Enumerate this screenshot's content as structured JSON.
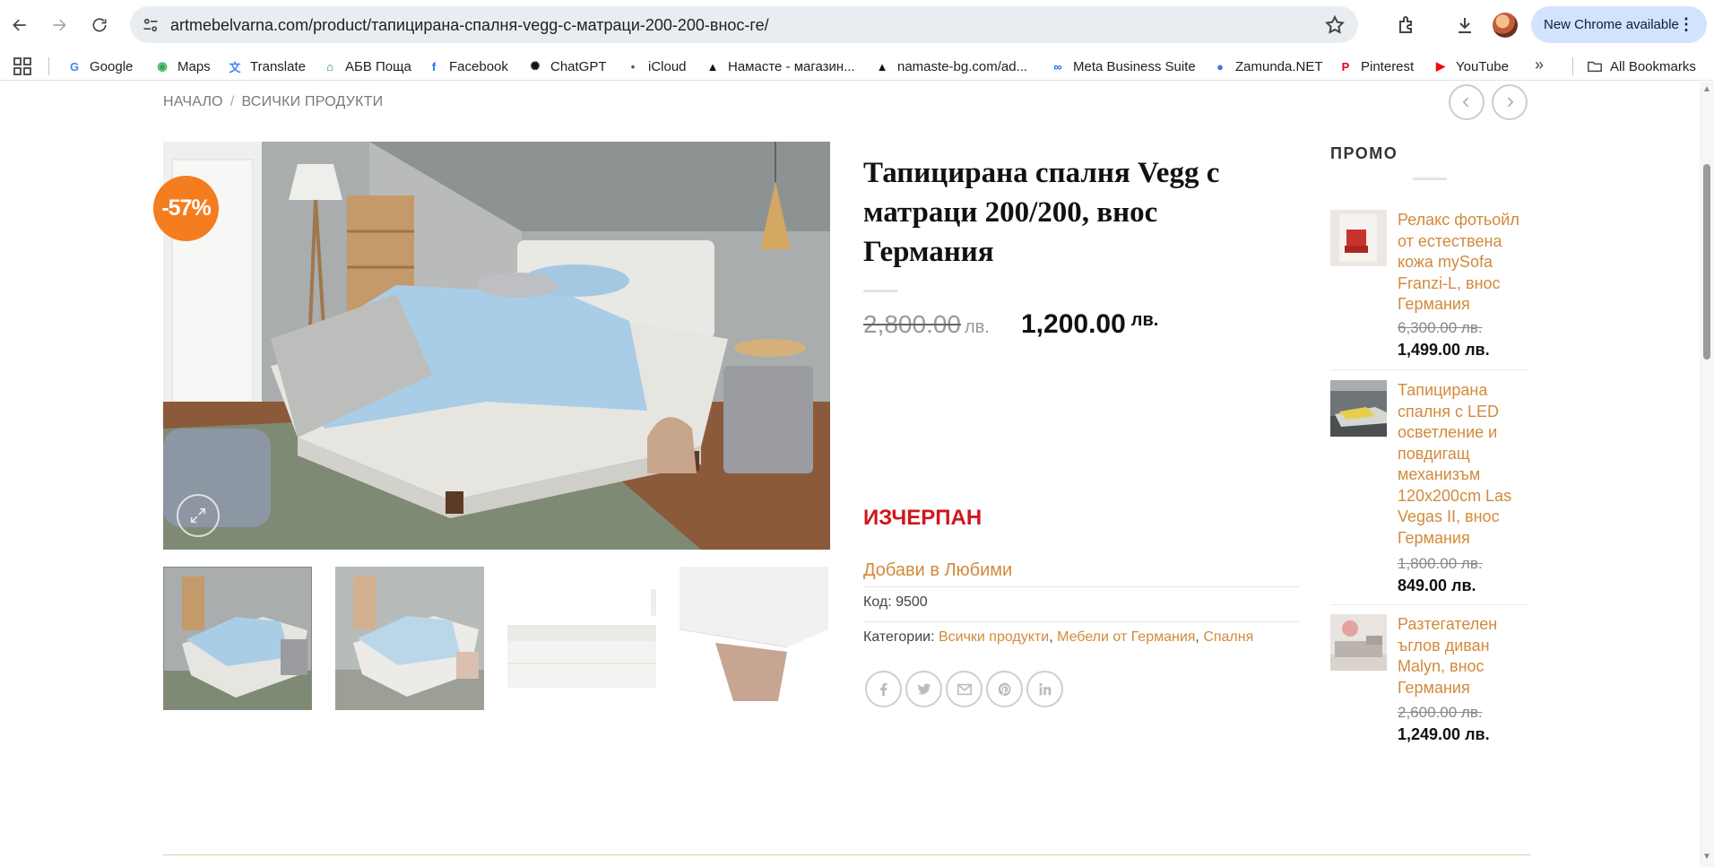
{
  "browser": {
    "url": "artmebelvarna.com/product/тапицирана-спалня-vegg-с-матраци-200-200-внос-ге/",
    "new_chrome_label": "New Chrome available",
    "bookmarks": [
      {
        "label": "Google",
        "icon": "google-icon",
        "color": "#4285f4"
      },
      {
        "label": "Maps",
        "icon": "maps-icon",
        "color": "#34a853"
      },
      {
        "label": "Translate",
        "icon": "translate-icon",
        "color": "#4285f4"
      },
      {
        "label": "АБВ Поща",
        "icon": "abv-mail-icon",
        "color": "#2e8b3a"
      },
      {
        "label": "Facebook",
        "icon": "facebook-icon",
        "color": "#1877f2"
      },
      {
        "label": "ChatGPT",
        "icon": "chatgpt-icon",
        "color": "#111111"
      },
      {
        "label": "iCloud",
        "icon": "apple-icon",
        "color": "#555555"
      },
      {
        "label": "Намасте - магазин...",
        "icon": "mountain-icon",
        "color": "#111111"
      },
      {
        "label": "namaste-bg.com/ad...",
        "icon": "mountain-icon",
        "color": "#111111"
      },
      {
        "label": "Meta Business Suite",
        "icon": "meta-icon",
        "color": "#0866ff"
      },
      {
        "label": "Zamunda.NET",
        "icon": "zamunda-icon",
        "color": "#3a7bd5"
      },
      {
        "label": "Pinterest",
        "icon": "pinterest-icon",
        "color": "#e60023"
      },
      {
        "label": "YouTube",
        "icon": "youtube-icon",
        "color": "#ff0000"
      }
    ],
    "all_bookmarks_label": "All Bookmarks"
  },
  "breadcrumb": {
    "home": "НАЧАЛО",
    "separator": "/",
    "current": "ВСИЧКИ ПРОДУКТИ"
  },
  "product": {
    "title": "Тапицирана спалня Vegg с матраци 200/200, внос Германия",
    "discount_badge": "-57%",
    "old_price": "2,800.00",
    "new_price": "1,200.00",
    "currency": "лв.",
    "stock_status": "ИЗЧЕРПАН",
    "wishlist_label": "Добави в Любими",
    "sku_label": "Код:",
    "sku": "9500",
    "categories_label": "Категории:",
    "categories": [
      "Всички продукти",
      "Мебели от Германия",
      "Спалня"
    ],
    "share_icons": [
      "facebook-icon",
      "twitter-icon",
      "email-icon",
      "pinterest-icon",
      "linkedin-icon"
    ]
  },
  "sidebar": {
    "title": "ПРОМО",
    "items": [
      {
        "name": "Релакс фотьойл от естествена кожа mySofa Franzi-L, внос Германия",
        "old_price": "6,300.00 лв.",
        "new_price": "1,499.00 лв."
      },
      {
        "name": "Тапицирана спалня с LED осветление и повдигащ механизъм 120x200cm Las Vegas II, внос Германия",
        "old_price": "1,800.00 лв.",
        "new_price": "849.00 лв."
      },
      {
        "name": "Разтегателен ъглов диван Malyn, внос Германия",
        "old_price": "2,600.00 лв.",
        "new_price": "1,249.00 лв."
      }
    ]
  },
  "colors": {
    "accent": "#d28a3b",
    "badge": "#f47d20",
    "out_of_stock": "#d0161b"
  }
}
